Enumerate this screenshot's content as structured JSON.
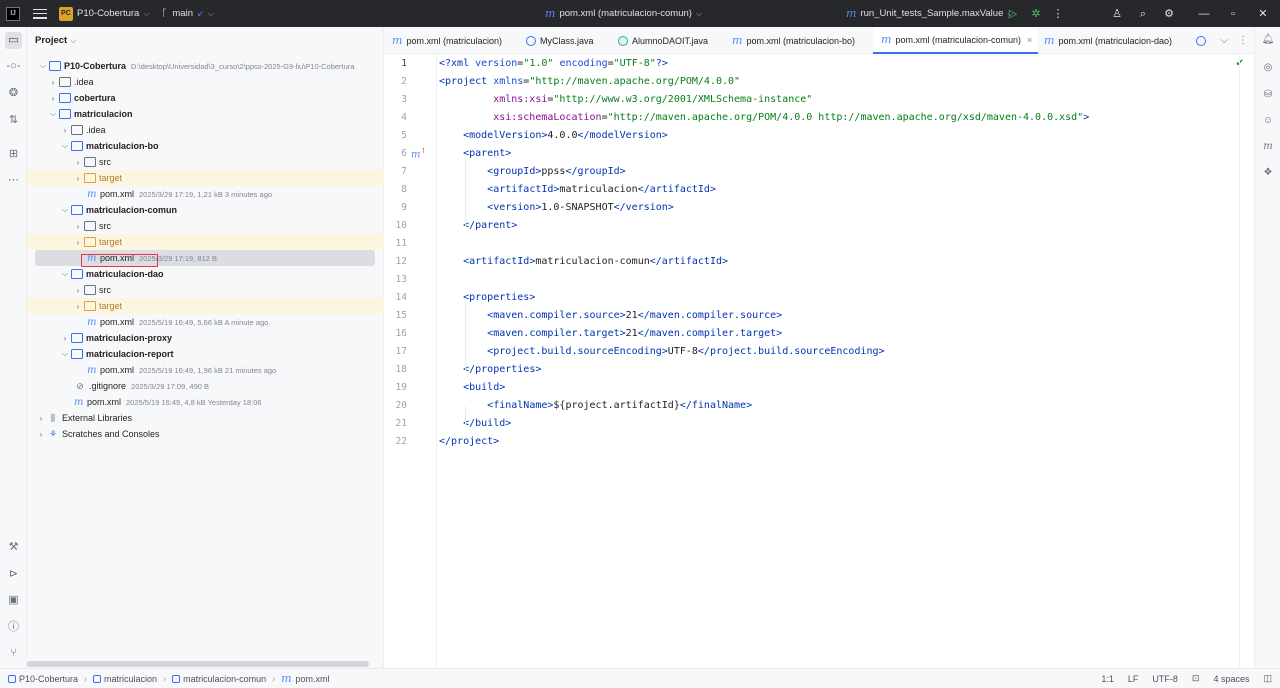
{
  "titlebar": {
    "project_badge": "PC",
    "project_name": "P10-Cobertura",
    "branch": "main",
    "center_file": "pom.xml (matriculacion-comun)",
    "run_config": "run_Unit_tests_Sample.maxValue"
  },
  "project_panel": {
    "title": "Project",
    "tree": [
      {
        "name": "P10-Cobertura",
        "meta": "D:\\desktop\\Universidad\\3_curso\\2\\ppss-2025-G9-liu\\P10-Cobertura"
      },
      {
        "name": ".idea"
      },
      {
        "name": "cobertura"
      },
      {
        "name": "matriculacion"
      },
      {
        "name": ".idea"
      },
      {
        "name": "matriculacion-bo"
      },
      {
        "name": "src"
      },
      {
        "name": "target"
      },
      {
        "name": "pom.xml",
        "meta": "2025/3/29 17:19, 1,21 kB 3 minutes ago"
      },
      {
        "name": "matriculacion-comun"
      },
      {
        "name": "src"
      },
      {
        "name": "target"
      },
      {
        "name": "pom.xml",
        "meta": "2025/3/29 17:19, 812 B"
      },
      {
        "name": "matriculacion-dao"
      },
      {
        "name": "src"
      },
      {
        "name": "target"
      },
      {
        "name": "pom.xml",
        "meta": "2025/5/19 16:49, 5,66 kB A minute ago"
      },
      {
        "name": "matriculacion-proxy"
      },
      {
        "name": "matriculacion-report"
      },
      {
        "name": "pom.xml",
        "meta": "2025/5/19 16:49, 1,96 kB 21 minutes ago"
      },
      {
        "name": ".gitignore",
        "meta": "2025/3/29 17:09, 490 B"
      },
      {
        "name": "pom.xml",
        "meta": "2025/5/19 16:49, 4,8 kB Yesterday 18:06"
      },
      {
        "name": "External Libraries"
      },
      {
        "name": "Scratches and Consoles"
      }
    ]
  },
  "tabs": [
    {
      "label": "pom.xml (matriculacion)"
    },
    {
      "label": "MyClass.java"
    },
    {
      "label": "AlumnoDAOIT.java"
    },
    {
      "label": "pom.xml (matriculacion-bo)"
    },
    {
      "label": "pom.xml (matriculacion-comun)",
      "close": "×"
    },
    {
      "label": "pom.xml (matriculacion-dao)"
    }
  ],
  "editor": {
    "line_numbers": [
      "1",
      "2",
      "3",
      "4",
      "5",
      "6",
      "7",
      "8",
      "9",
      "10",
      "11",
      "12",
      "13",
      "14",
      "15",
      "16",
      "17",
      "18",
      "19",
      "20",
      "21",
      "22"
    ],
    "lines": [
      [
        [
          "t-tag",
          "<?xml "
        ],
        [
          "t-attr",
          "version"
        ],
        [
          "t-txt",
          "="
        ],
        [
          "t-val",
          "\"1.0\""
        ],
        [
          "t-txt",
          " "
        ],
        [
          "t-attr",
          "encoding"
        ],
        [
          "t-txt",
          "="
        ],
        [
          "t-val",
          "\"UTF-8\""
        ],
        [
          "t-tag",
          "?>"
        ]
      ],
      [
        [
          "t-tag",
          "<project "
        ],
        [
          "t-attr",
          "xmlns"
        ],
        [
          "t-txt",
          "="
        ],
        [
          "t-val",
          "\"http://maven.apache.org/POM/4.0.0\""
        ]
      ],
      [
        [
          "t-txt",
          "         "
        ],
        [
          "t-ns",
          "xmlns:xsi"
        ],
        [
          "t-txt",
          "="
        ],
        [
          "t-val",
          "\"http://www.w3.org/2001/XMLSchema-instance\""
        ]
      ],
      [
        [
          "t-txt",
          "         "
        ],
        [
          "t-ns",
          "xsi:schemaLocation"
        ],
        [
          "t-txt",
          "="
        ],
        [
          "t-val",
          "\"http://maven.apache.org/POM/4.0.0 http://maven.apache.org/xsd/maven-4.0.0.xsd\""
        ],
        [
          "t-tag",
          ">"
        ]
      ],
      [
        [
          "t-txt",
          "    "
        ],
        [
          "t-tag",
          "<modelVersion>"
        ],
        [
          "t-txt",
          "4.0.0"
        ],
        [
          "t-tag",
          "</modelVersion>"
        ]
      ],
      [
        [
          "t-txt",
          "    "
        ],
        [
          "t-tag",
          "<parent>"
        ]
      ],
      [
        [
          "t-txt",
          "        "
        ],
        [
          "t-tag",
          "<groupId>"
        ],
        [
          "t-txt",
          "ppss"
        ],
        [
          "t-tag",
          "</groupId>"
        ]
      ],
      [
        [
          "t-txt",
          "        "
        ],
        [
          "t-tag",
          "<artifactId>"
        ],
        [
          "t-txt",
          "matriculacion"
        ],
        [
          "t-tag",
          "</artifactId>"
        ]
      ],
      [
        [
          "t-txt",
          "        "
        ],
        [
          "t-tag",
          "<version>"
        ],
        [
          "t-txt",
          "1.0-SNAPSHOT"
        ],
        [
          "t-tag",
          "</version>"
        ]
      ],
      [
        [
          "t-txt",
          "    "
        ],
        [
          "t-tag",
          "</parent>"
        ]
      ],
      [],
      [
        [
          "t-txt",
          "    "
        ],
        [
          "t-tag",
          "<artifactId>"
        ],
        [
          "t-txt",
          "matriculacion-comun"
        ],
        [
          "t-tag",
          "</artifactId>"
        ]
      ],
      [],
      [
        [
          "t-txt",
          "    "
        ],
        [
          "t-tag",
          "<properties>"
        ]
      ],
      [
        [
          "t-txt",
          "        "
        ],
        [
          "t-tag",
          "<maven.compiler.source>"
        ],
        [
          "t-txt",
          "21"
        ],
        [
          "t-tag",
          "</maven.compiler.source>"
        ]
      ],
      [
        [
          "t-txt",
          "        "
        ],
        [
          "t-tag",
          "<maven.compiler.target>"
        ],
        [
          "t-txt",
          "21"
        ],
        [
          "t-tag",
          "</maven.compiler.target>"
        ]
      ],
      [
        [
          "t-txt",
          "        "
        ],
        [
          "t-tag",
          "<project.build.sourceEncoding>"
        ],
        [
          "t-txt",
          "UTF-8"
        ],
        [
          "t-tag",
          "</project.build.sourceEncoding>"
        ]
      ],
      [
        [
          "t-txt",
          "    "
        ],
        [
          "t-tag",
          "</properties>"
        ]
      ],
      [
        [
          "t-txt",
          "    "
        ],
        [
          "t-tag",
          "<build>"
        ]
      ],
      [
        [
          "t-txt",
          "        "
        ],
        [
          "t-tag",
          "<finalName>"
        ],
        [
          "t-txt",
          "${project.artifactId}"
        ],
        [
          "t-tag",
          "</finalName>"
        ]
      ],
      [
        [
          "t-txt",
          "    "
        ],
        [
          "t-tag",
          "</build>"
        ]
      ],
      [
        [
          "t-tag",
          "</project>"
        ]
      ]
    ]
  },
  "statusbar": {
    "breadcrumbs": [
      "P10-Cobertura",
      "matriculacion",
      "matriculacion-comun",
      "pom.xml"
    ],
    "position": "1:1",
    "line_ending": "LF",
    "encoding": "UTF-8",
    "indent": "4 spaces"
  }
}
